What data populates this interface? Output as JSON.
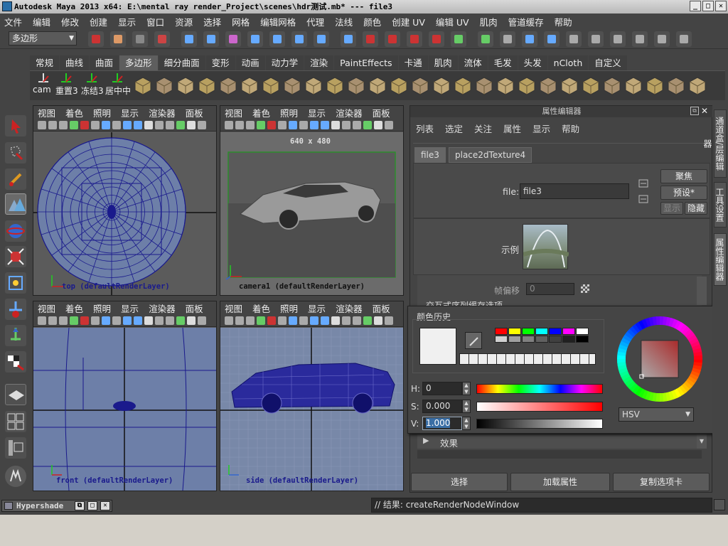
{
  "window": {
    "title": "Autodesk Maya 2013 x64: E:\\mental ray render_Project\\scenes\\hdr测试.mb*    ---    file3"
  },
  "menubar": [
    "文件",
    "编辑",
    "修改",
    "创建",
    "显示",
    "窗口",
    "资源",
    "选择",
    "网格",
    "编辑网格",
    "代理",
    "法线",
    "颜色",
    "创建 UV",
    "编辑 UV",
    "肌肉",
    "管道缓存",
    "帮助"
  ],
  "mode_selector": {
    "value": "多边形"
  },
  "shelf_tabs": [
    "常规",
    "曲线",
    "曲面",
    "多边形",
    "细分曲面",
    "变形",
    "动画",
    "动力学",
    "渲染",
    "PaintEffects",
    "卡通",
    "肌肉",
    "流体",
    "毛发",
    "头发",
    "nCloth",
    "自定义"
  ],
  "shelf_active": "多边形",
  "shelf_labels": {
    "cam": "cam",
    "reset": "重置3",
    "freeze": "冻结3",
    "center": "居中中"
  },
  "viewport_menu": [
    "视图",
    "着色",
    "照明",
    "显示",
    "渲染器",
    "面板"
  ],
  "viewports": {
    "top": {
      "caption": "top (defaultRenderLayer)"
    },
    "camera": {
      "caption": "camera1 (defaultRenderLayer)",
      "resolution": "640 x 480"
    },
    "front": {
      "caption": "front (defaultRenderLayer)"
    },
    "side": {
      "caption": "side (defaultRenderLayer)"
    }
  },
  "attribute_editor": {
    "header": "属性编辑器",
    "menu": [
      "列表",
      "选定",
      "关注",
      "属性",
      "显示",
      "帮助"
    ],
    "tabs": [
      "file3",
      "place2dTexture4"
    ],
    "file_label": "file:",
    "file_value": "file3",
    "focus_button": "聚焦",
    "preset_button": "预设*",
    "show_button": "显示",
    "hide_button": "隐藏",
    "sample_label": "示例",
    "frame_offset_label": "帧偏移",
    "frame_offset_value": "0",
    "section_interactive": "交互式序列缓存选项",
    "section_effects": "效果",
    "bottom_buttons": [
      "选择",
      "加载属性",
      "复制选项卡"
    ]
  },
  "color_picker": {
    "history_label": "颜色历史",
    "h_label": "H:",
    "h_value": "0",
    "s_label": "S:",
    "s_value": "0.000",
    "v_label": "V:",
    "v_value": "1.000",
    "mode": "HSV",
    "swatches": [
      "#ff0000",
      "#ffff00",
      "#00ff00",
      "#00ffff",
      "#0000ff",
      "#ff00ff",
      "#ffffff",
      "#d0d0d0",
      "#a0a0a0",
      "#808080",
      "#606060",
      "#404040",
      "#202020",
      "#000000"
    ]
  },
  "side_tabs": [
    "通道盒/层编辑器",
    "工具设置",
    "属性编辑器"
  ],
  "hypershade": {
    "label": "Hypershade"
  },
  "command_result": "// 结果: createRenderNodeWindow",
  "colors": {
    "wire_blue": "#1a1a8c",
    "hotkey_red": "#e02020"
  }
}
